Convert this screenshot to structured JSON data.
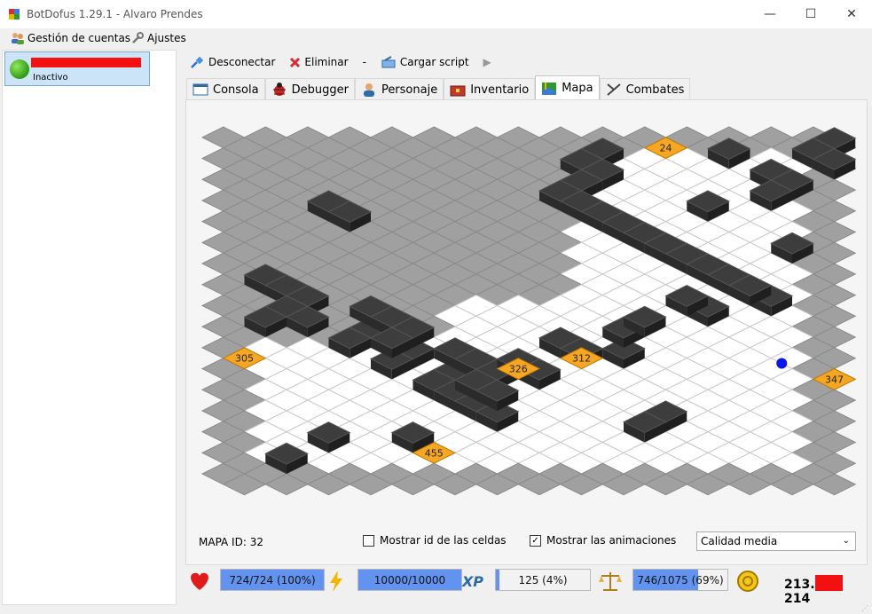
{
  "window": {
    "title": "BotDofus 1.29.1 - Alvaro Prendes",
    "minimize": "—",
    "maximize": "☐",
    "close": "✕"
  },
  "menu": {
    "accounts": "Gestión de cuentas",
    "settings": "Ajustes"
  },
  "account": {
    "status": "Inactivo"
  },
  "toolbar": {
    "disconnect": "Desconectar",
    "delete": "Eliminar",
    "separator": "-",
    "load_script": "Cargar script",
    "play": "▶"
  },
  "tabs": [
    {
      "label": "Consola",
      "icon": "console-icon"
    },
    {
      "label": "Debugger",
      "icon": "bug-icon"
    },
    {
      "label": "Personaje",
      "icon": "character-icon"
    },
    {
      "label": "Inventario",
      "icon": "chest-icon"
    },
    {
      "label": "Mapa",
      "icon": "map-icon",
      "active": true
    },
    {
      "label": "Combates",
      "icon": "swords-icon"
    }
  ],
  "map": {
    "id_label": "MAPA ID: 32",
    "cell_labels": [
      "24",
      "305",
      "326",
      "312",
      "347",
      "455"
    ],
    "show_cell_ids": {
      "label": "Mostrar id de las celdas",
      "checked": false
    },
    "show_animations": {
      "label": "Mostrar las animaciones",
      "checked": true,
      "mark": "✓"
    },
    "quality": "Calidad media",
    "colors": {
      "walkable": "#ffffff",
      "blocked": "#a0a0a0",
      "obstacle": "#3d3d3d",
      "trigger": "#f5a623",
      "player": "#0b15ee"
    }
  },
  "status": {
    "life": {
      "text": "724/724 (100%)",
      "fraction": 1.0
    },
    "energy": {
      "text": "10000/10000",
      "fraction": 1.0
    },
    "xp": {
      "text": "125 (4%)",
      "fraction": 0.04,
      "badge": "XP"
    },
    "weight": {
      "text": "746/1075 (69%)",
      "fraction": 0.69
    },
    "kamas_start": "213.",
    "kamas_end": "214"
  }
}
